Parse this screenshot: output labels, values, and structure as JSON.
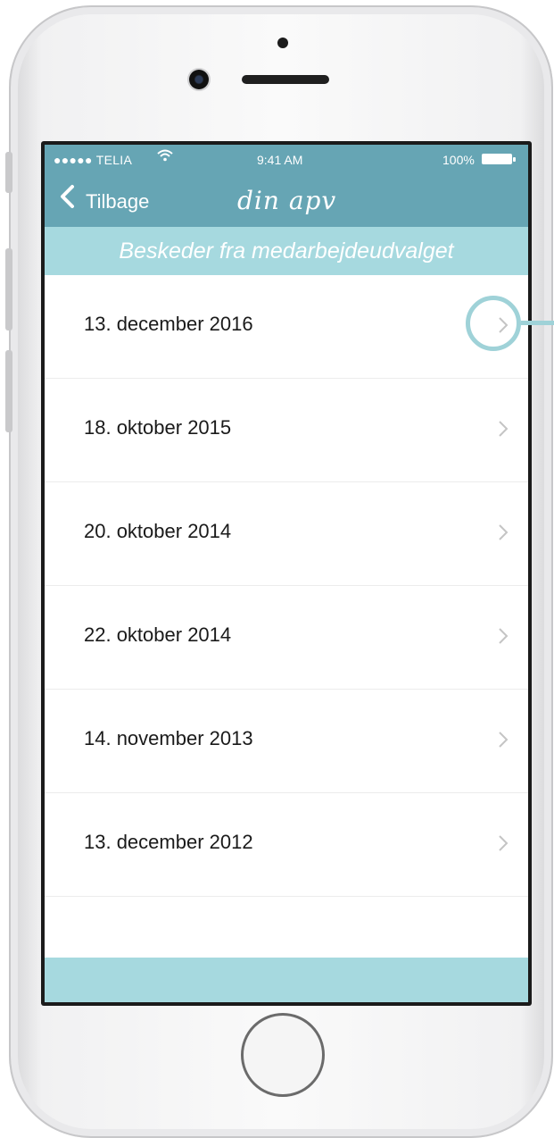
{
  "status_bar": {
    "carrier": "●●●●● TELIA",
    "wifi_icon": "wifi-icon",
    "time": "9:41 AM",
    "battery": "100%"
  },
  "nav": {
    "back_label": "Tilbage",
    "title": "din apv"
  },
  "subheader": "Beskeder fra medarbejdeudvalget",
  "messages": [
    {
      "label": "13. december 2016"
    },
    {
      "label": "18. oktober 2015"
    },
    {
      "label": "20. oktober 2014"
    },
    {
      "label": "22. oktober 2014"
    },
    {
      "label": "14. november 2013"
    },
    {
      "label": "13. december 2012"
    }
  ],
  "colors": {
    "nav_bar": "#66a5b4",
    "subheader": "#a6d9df",
    "highlight": "#9fd2d8"
  }
}
